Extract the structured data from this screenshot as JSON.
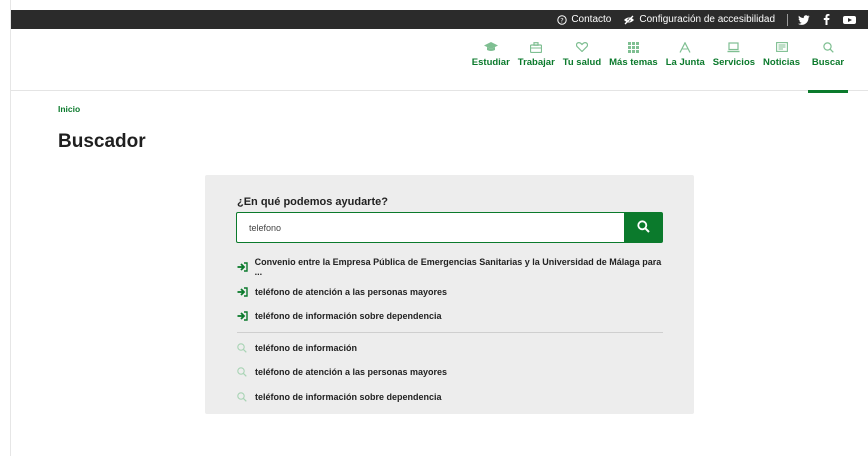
{
  "topbar": {
    "contact_label": "Contacto",
    "accessibility_label": "Configuración de accesibilidad"
  },
  "nav": {
    "items": [
      {
        "label": "Estudiar",
        "icon": "graduation-cap-icon"
      },
      {
        "label": "Trabajar",
        "icon": "briefcase-icon"
      },
      {
        "label": "Tu salud",
        "icon": "heart-icon"
      },
      {
        "label": "Más temas",
        "icon": "grid-icon"
      },
      {
        "label": "La Junta",
        "icon": "junta-logo-icon"
      },
      {
        "label": "Servicios",
        "icon": "laptop-icon"
      },
      {
        "label": "Noticias",
        "icon": "newspaper-icon"
      },
      {
        "label": "Buscar",
        "icon": "search-icon"
      }
    ]
  },
  "breadcrumb": {
    "home": "Inicio"
  },
  "page": {
    "title": "Buscador"
  },
  "search": {
    "question": "¿En qué podemos ayudarte?",
    "value": "telefono"
  },
  "suggestions": {
    "pages": [
      "Convenio entre la Empresa Pública de Emergencias Sanitarias y la Universidad de Málaga para ...",
      "teléfono de atención a las personas mayores",
      "teléfono de información sobre dependencia"
    ],
    "terms": [
      "teléfono de información",
      "teléfono de atención a las personas mayores",
      "teléfono de información sobre dependencia"
    ]
  },
  "colors": {
    "brand_green": "#0b7a2c",
    "topbar_bg": "#2b2b2b",
    "panel_bg": "#ededed"
  }
}
